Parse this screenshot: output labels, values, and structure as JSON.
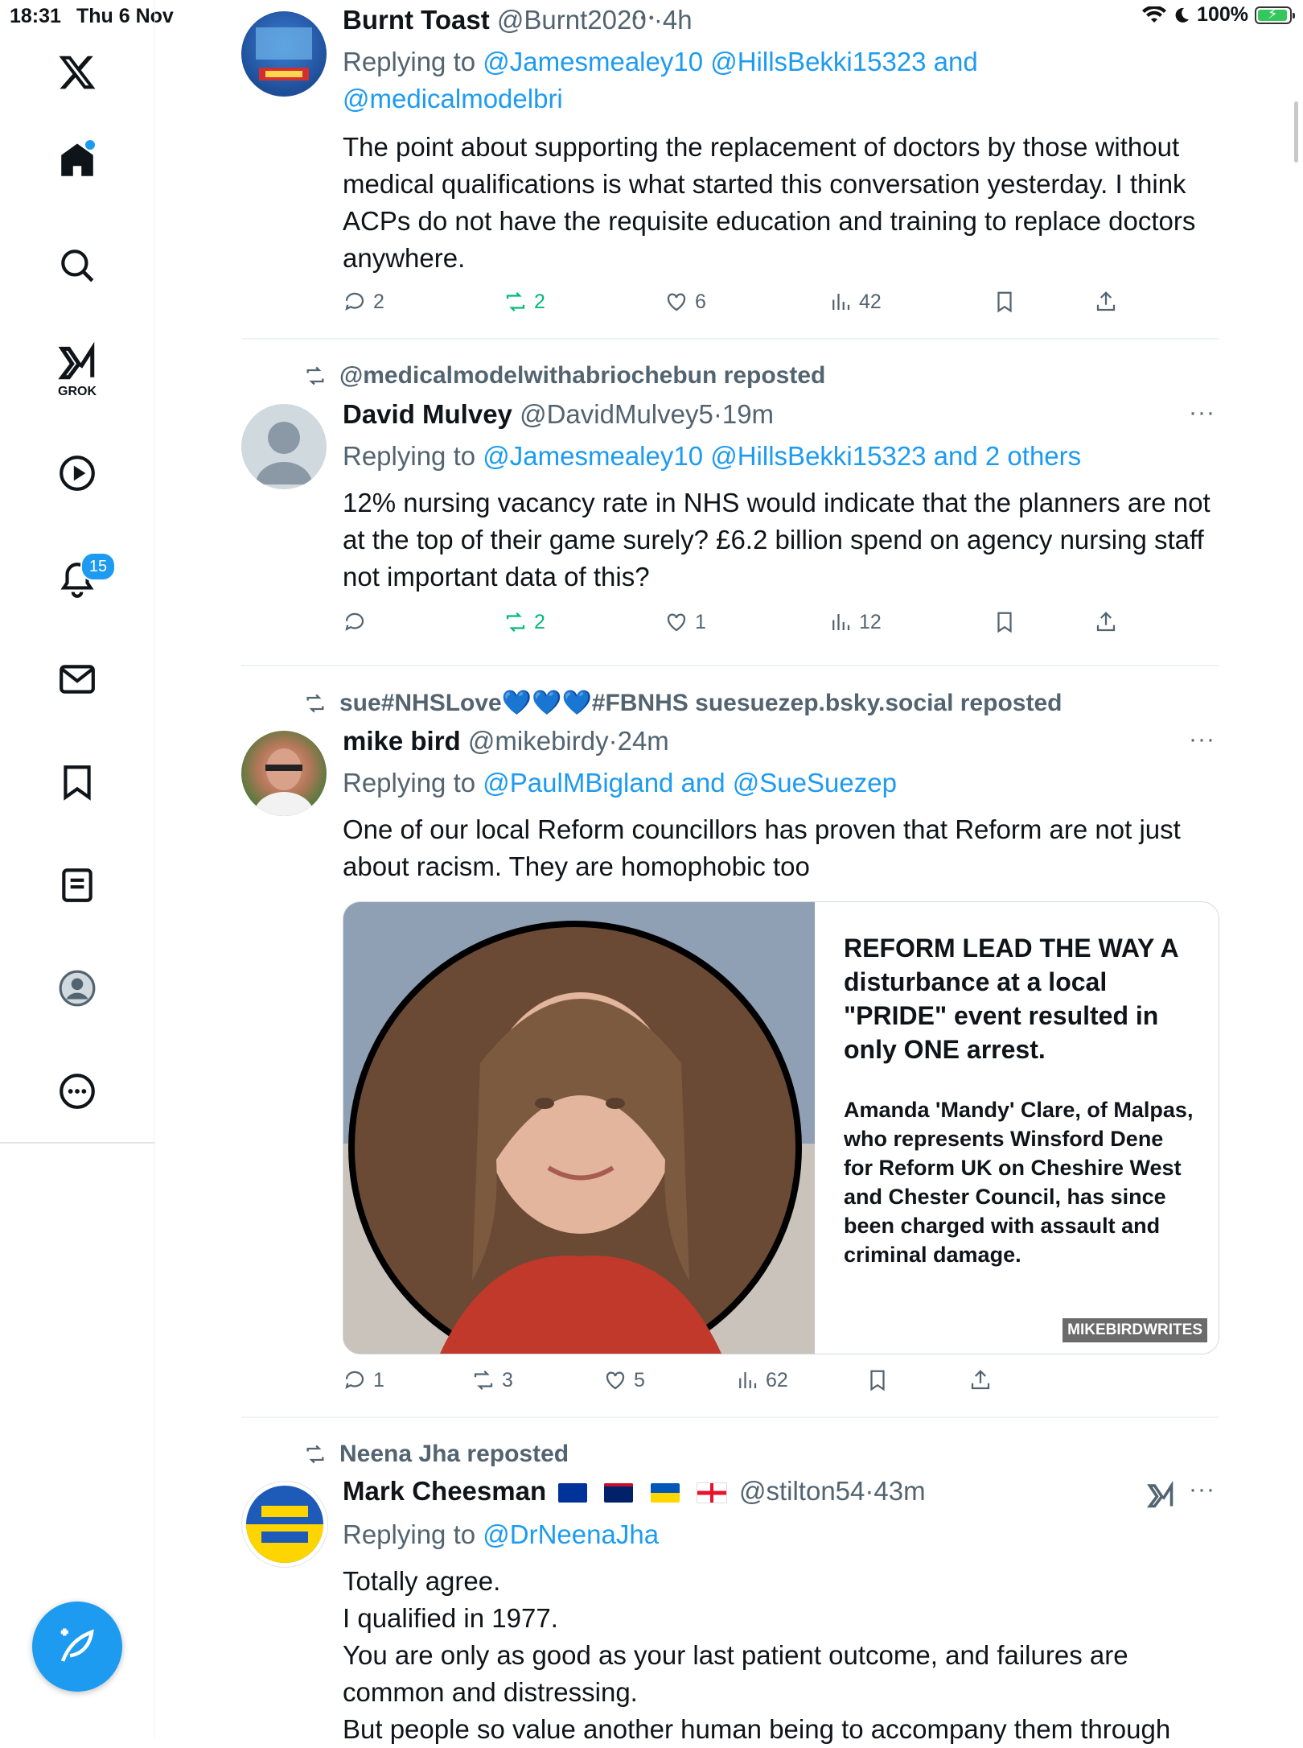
{
  "status_bar": {
    "time": "18:31",
    "date": "Thu 6 Nov",
    "battery": "100%"
  },
  "sidebar": {
    "grok_label": "GROK",
    "notifications_badge": "15"
  },
  "tweets": [
    {
      "name": "Burnt Toast",
      "handle": "@Burnt2020",
      "time": "4h",
      "replying_prefix": "Replying to",
      "replying_to_1": "@Jamesmealey10 @HillsBekki15323 and",
      "replying_to_2": "@medicalmodelbri",
      "text": "The point about supporting the replacement of doctors by those without medical qualifications is what started this conversation yesterday. I think ACPs do not have the requisite education and training to replace doctors anywhere.",
      "replies": "2",
      "reposts": "2",
      "likes": "6",
      "views": "42"
    },
    {
      "reposted_by": "@medicalmodelwithabriochebun reposted",
      "name": "David Mulvey",
      "handle": "@DavidMulvey5",
      "time": "19m",
      "replying_prefix": "Replying to",
      "replying_to_1": "@Jamesmealey10 @HillsBekki15323 and 2 others",
      "text": "12% nursing vacancy rate in NHS would indicate that the planners are not at the top of their game surely? £6.2 billion spend on agency nursing staff not important data of this?",
      "replies": "",
      "reposts": "2",
      "likes": "1",
      "views": "12"
    },
    {
      "reposted_by": "sue#NHSLove💙💙💙#FBNHS suesuezep.bsky.social reposted",
      "name": "mike bird",
      "handle": "@mikebirdy",
      "time": "24m",
      "replying_prefix": "Replying to",
      "replying_to_1": "@PaulMBigland and @SueSuezep",
      "text": "One of our local Reform councillors has proven that Reform are not just about racism. They are homophobic too",
      "card_headline": "REFORM LEAD THE WAY A disturbance at a local \"PRIDE\" event resulted in only ONE arrest.",
      "card_body": "Amanda 'Mandy' Clare, of Malpas, who represents Winsford Dene for Reform UK on Cheshire West and Chester Council, has since been charged with assault and criminal damage.",
      "card_tag": "MIKEBIRDWRITES",
      "replies": "1",
      "reposts": "3",
      "likes": "5",
      "views": "62"
    },
    {
      "reposted_by": "Neena Jha reposted",
      "name": "Mark Cheesman",
      "handle": "@stilton54",
      "time": "43m",
      "replying_prefix": "Replying to",
      "replying_to_1": "@DrNeenaJha",
      "text_lines": [
        "Totally agree.",
        "I qualified in 1977.",
        "You are only as good as your last patient outcome, and failures are common and distressing.",
        "But people so value another human being to accompany them through"
      ]
    }
  ],
  "separator": "·",
  "more_label": "···"
}
